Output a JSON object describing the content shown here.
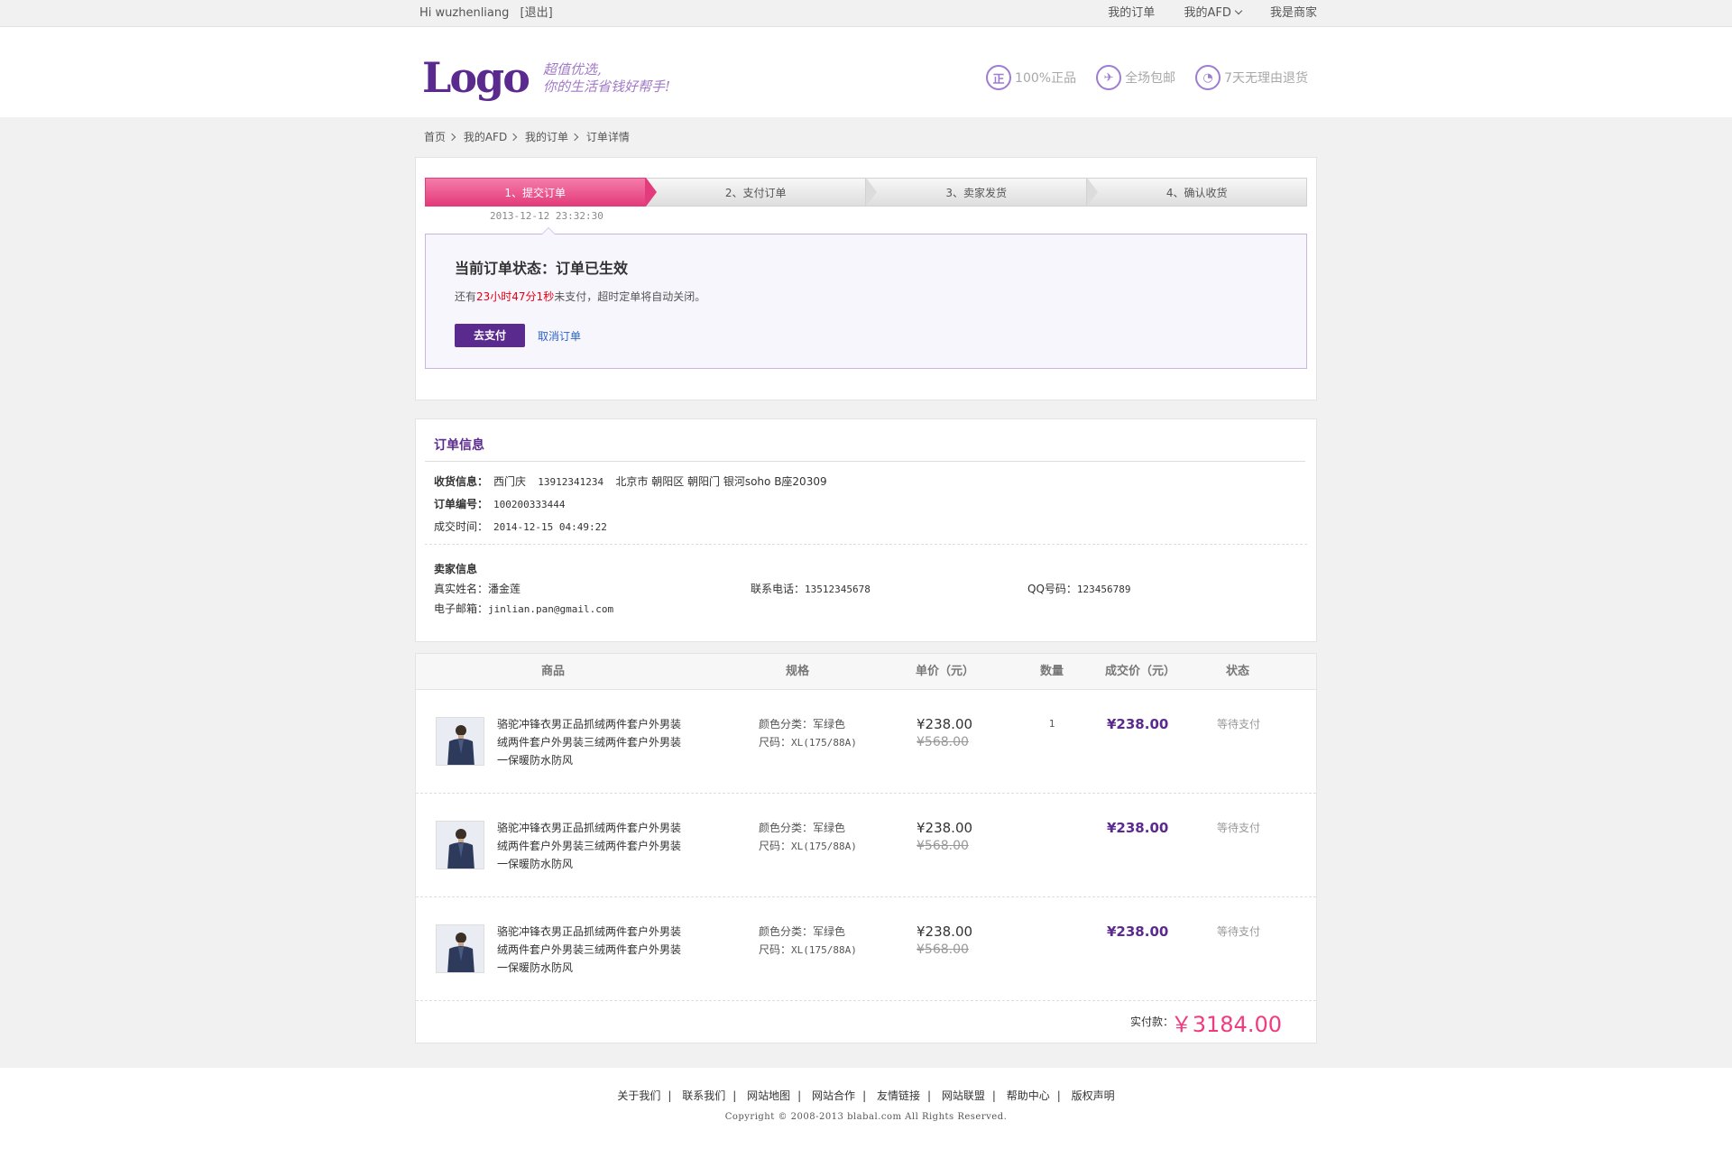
{
  "topbar": {
    "greeting": "Hi wuzhenliang",
    "logout": "[退出]",
    "links": [
      "我的订单",
      "我的AFD",
      "我是商家"
    ]
  },
  "header": {
    "logo": "Logo",
    "slogan_line1": "超值优选,",
    "slogan_line2": "你的生活省钱好帮手!",
    "guarantees": [
      {
        "icon": "genuine-icon",
        "glyph": "正",
        "label": "100%正品"
      },
      {
        "icon": "free-shipping-icon",
        "glyph": "✈",
        "label": "全场包邮"
      },
      {
        "icon": "return-clock-icon",
        "glyph": "◔",
        "label": "7天无理由退货"
      }
    ]
  },
  "breadcrumb": [
    "首页",
    "我的AFD",
    "我的订单",
    "订单详情"
  ],
  "steps": {
    "items": [
      "1、提交订单",
      "2、支付订单",
      "3、卖家发货",
      "4、确认收货"
    ],
    "active_index": 0,
    "time": "2013-12-12  23:32:30"
  },
  "status": {
    "title": "当前订单状态：订单已生效",
    "note_prefix": "还有",
    "countdown": "23小时47分1秒",
    "note_suffix": "未支付，超时定单将自动关闭。",
    "pay_button": "去支付",
    "cancel_link": "取消订单"
  },
  "order_info": {
    "title": "订单信息",
    "receiver_label": "收货信息：",
    "receiver_name": "西门庆",
    "receiver_phone": "13912341234",
    "receiver_address": "北京市 朝阳区 朝阳门 银河soho B座20309",
    "order_no_label": "订单编号：",
    "order_no": "100200333444",
    "deal_time_label": "成交时间：",
    "deal_time": "2014-12-15 04:49:22",
    "seller_title": "卖家信息",
    "real_name_label": "真实姓名：",
    "real_name": "潘金莲",
    "phone_label": "联系电话：",
    "phone": "13512345678",
    "qq_label": "QQ号码：",
    "qq": "123456789",
    "email_label": "电子邮箱：",
    "email": "jinlian.pan@gmail.com"
  },
  "goods": {
    "headers": [
      "商品",
      "规格",
      "单价（元）",
      "数量",
      "成交价（元）",
      "状态"
    ],
    "rows": [
      {
        "name": "骆驼冲锋衣男正品抓绒两件套户外男装绒两件套户外男装三绒两件套户外男装一保暖防水防风",
        "color": "颜色分类：军绿色",
        "size_label": "尺码：",
        "size": "XL(175/88A)",
        "price": "¥238.00",
        "old_price": "¥568.00",
        "qty": "1",
        "deal": "¥238.00",
        "status": "等待支付"
      },
      {
        "name": "骆驼冲锋衣男正品抓绒两件套户外男装绒两件套户外男装三绒两件套户外男装一保暖防水防风",
        "color": "颜色分类：军绿色",
        "size_label": "尺码：",
        "size": "XL(175/88A)",
        "price": "¥238.00",
        "old_price": "¥568.00",
        "qty": "",
        "deal": "¥238.00",
        "status": "等待支付"
      },
      {
        "name": "骆驼冲锋衣男正品抓绒两件套户外男装绒两件套户外男装三绒两件套户外男装一保暖防水防风",
        "color": "颜色分类：军绿色",
        "size_label": "尺码：",
        "size": "XL(175/88A)",
        "price": "¥238.00",
        "old_price": "¥568.00",
        "qty": "",
        "deal": "¥238.00",
        "status": "等待支付"
      }
    ],
    "total_label": "实付款：",
    "total": "￥3184.00"
  },
  "footer": {
    "links": [
      "关于我们",
      "联系我们",
      "网站地图",
      "网站合作",
      "友情链接",
      "网站联盟",
      "帮助中心",
      "版权声明"
    ],
    "copyright": "Copyright © 2008-2013 blabal.com All Rights Reserved."
  },
  "colors": {
    "brand": "#5b2a8e",
    "accent": "#e33b7b",
    "link": "#2b64c5"
  }
}
